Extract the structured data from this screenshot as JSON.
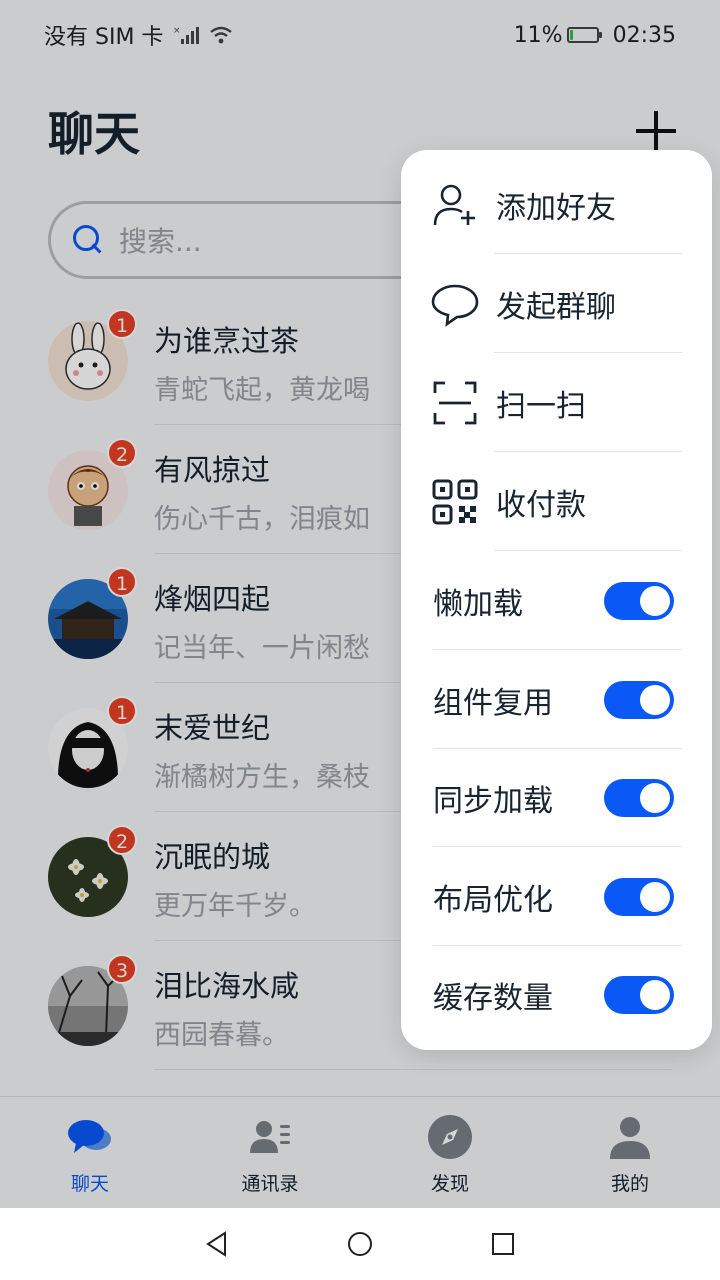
{
  "status_bar": {
    "carrier": "没有 SIM 卡",
    "battery": "11%",
    "battery_level": 0.11,
    "time": "02:35"
  },
  "header": {
    "title": "聊天"
  },
  "search": {
    "placeholder": "搜索..."
  },
  "chats": [
    {
      "name": "为谁烹过茶",
      "preview": "青蛇飞起，黄龙喝",
      "unread": "1"
    },
    {
      "name": "有风掠过",
      "preview": "伤心千古，泪痕如",
      "unread": "2"
    },
    {
      "name": "烽烟四起",
      "preview": "记当年、一片闲愁",
      "unread": "1"
    },
    {
      "name": "末爱世纪",
      "preview": "渐橘树方生，桑枝",
      "unread": "1"
    },
    {
      "name": "沉眠的城",
      "preview": "更万年千岁。",
      "unread": "2"
    },
    {
      "name": "泪比海水咸",
      "preview": "西园春暮。",
      "unread": "3"
    }
  ],
  "popup_menu": {
    "actions": [
      {
        "label": "添加好友",
        "icon": "add-friend-icon"
      },
      {
        "label": "发起群聊",
        "icon": "chat-bubble-icon"
      },
      {
        "label": "扫一扫",
        "icon": "scan-icon"
      },
      {
        "label": "收付款",
        "icon": "qr-code-icon"
      }
    ],
    "toggles": [
      {
        "label": "懒加载",
        "on": true
      },
      {
        "label": "组件复用",
        "on": true
      },
      {
        "label": "同步加载",
        "on": true
      },
      {
        "label": "布局优化",
        "on": true
      },
      {
        "label": "缓存数量",
        "on": true
      }
    ]
  },
  "tabs": [
    {
      "label": "聊天",
      "icon": "chat-icon",
      "active": true
    },
    {
      "label": "通讯录",
      "icon": "contacts-icon",
      "active": false
    },
    {
      "label": "发现",
      "icon": "compass-icon",
      "active": false
    },
    {
      "label": "我的",
      "icon": "profile-icon",
      "active": false
    }
  ],
  "colors": {
    "accent": "#0a59f7",
    "badge": "#e84026",
    "battery": "#2ec24d"
  }
}
